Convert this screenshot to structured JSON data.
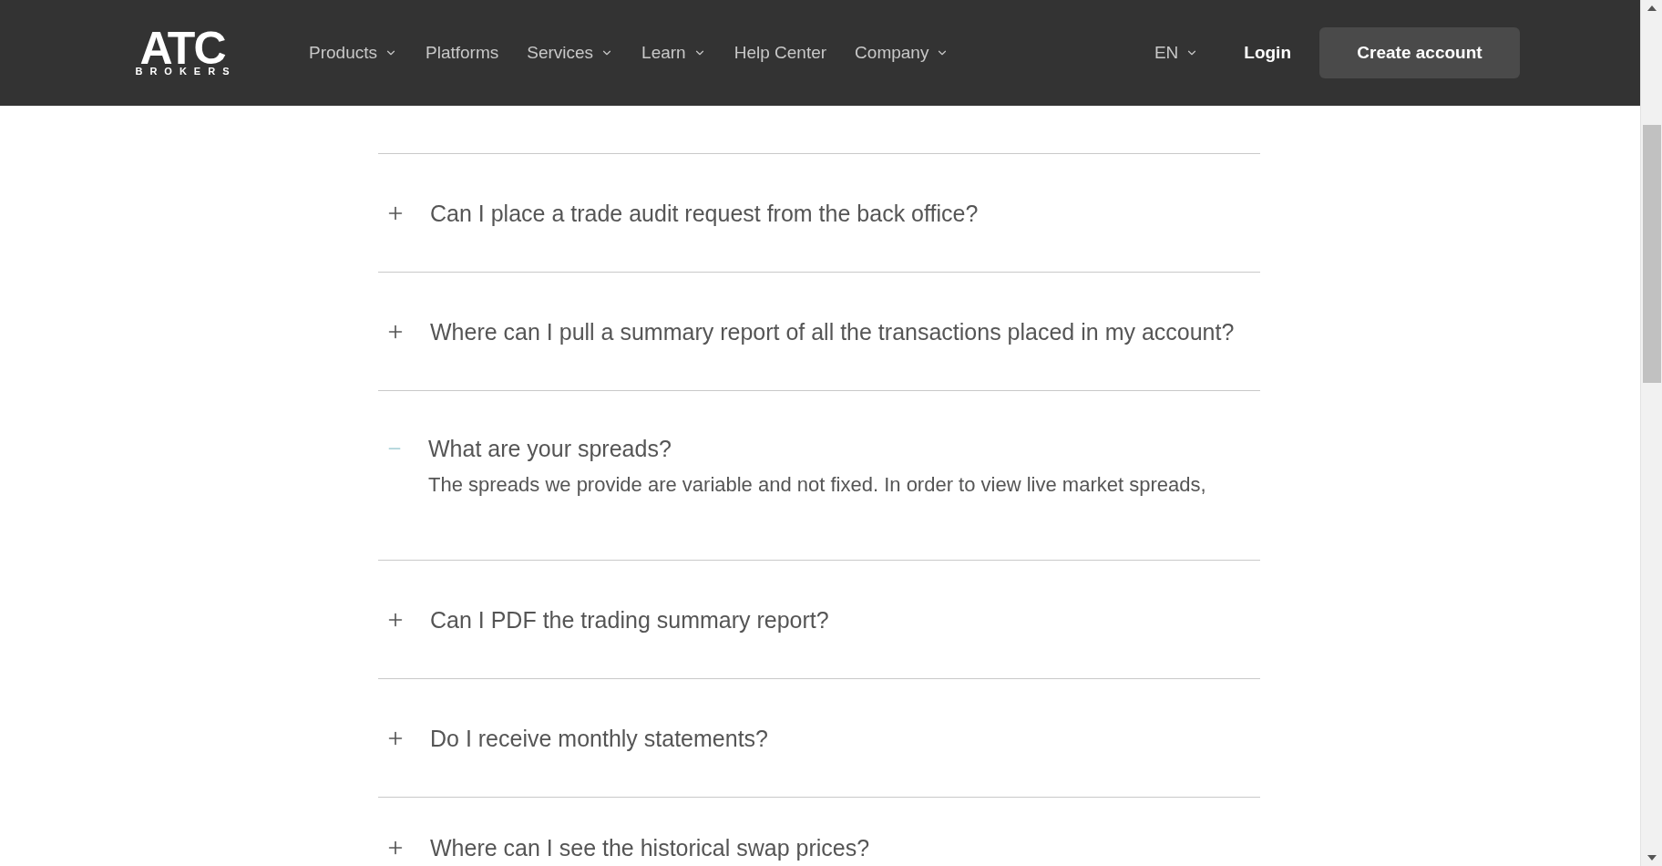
{
  "header": {
    "logo": {
      "name": "ATC",
      "tagline": "BROKERS"
    },
    "nav": [
      {
        "label": "Products",
        "has_menu": true
      },
      {
        "label": "Platforms",
        "has_menu": false
      },
      {
        "label": "Services",
        "has_menu": true
      },
      {
        "label": "Learn",
        "has_menu": true
      },
      {
        "label": "Help Center",
        "has_menu": false
      },
      {
        "label": "Company",
        "has_menu": true
      }
    ],
    "language": "EN",
    "login": "Login",
    "cta": "Create account"
  },
  "faq": [
    {
      "question": "Can I place a trade audit request from the back office?",
      "expanded": false
    },
    {
      "question": "Where can I pull a summary report of all the transactions placed in my account?",
      "expanded": false
    },
    {
      "question": "What are your spreads?",
      "expanded": true,
      "answer": "The spreads we provide are variable and not fixed. In order to view live market spreads,"
    },
    {
      "question": "Can I PDF the trading summary report?",
      "expanded": false
    },
    {
      "question": "Do I receive monthly statements?",
      "expanded": false
    },
    {
      "question": "Where can I see the historical swap prices?",
      "expanded": false
    }
  ]
}
